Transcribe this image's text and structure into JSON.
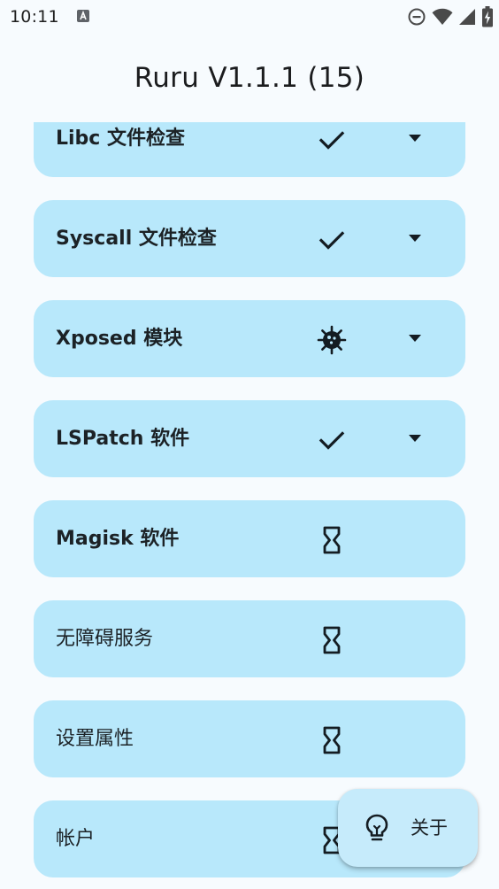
{
  "status_bar": {
    "time": "10:11",
    "left_icons": [
      "accessibility-a-icon"
    ],
    "right_icons": [
      "do-not-disturb-icon",
      "wifi-icon",
      "cell-signal-icon",
      "battery-charging-icon"
    ]
  },
  "header": {
    "title": "Ruru V1.1.1 (15)"
  },
  "checks": [
    {
      "label": "Libc 文件检查",
      "status_icon": "check-icon",
      "expandable": true
    },
    {
      "label": "Syscall 文件检查",
      "status_icon": "check-icon",
      "expandable": true
    },
    {
      "label": "Xposed 模块",
      "status_icon": "virus-icon",
      "expandable": true
    },
    {
      "label": "LSPatch 软件",
      "status_icon": "check-icon",
      "expandable": true
    },
    {
      "label": "Magisk 软件",
      "status_icon": "hourglass-icon",
      "expandable": false
    },
    {
      "label": "无障碍服务",
      "status_icon": "hourglass-icon",
      "expandable": false
    },
    {
      "label": "设置属性",
      "status_icon": "hourglass-icon",
      "expandable": false
    },
    {
      "label": "帐户",
      "status_icon": "hourglass-icon",
      "expandable": false
    }
  ],
  "fab": {
    "label": "关于",
    "icon": "lightbulb-icon"
  },
  "colors": {
    "background": "#f7fbfe",
    "card": "#b8e8fb",
    "fab": "#c6ebfb",
    "text": "#1c2226",
    "icon": "#141c22"
  }
}
